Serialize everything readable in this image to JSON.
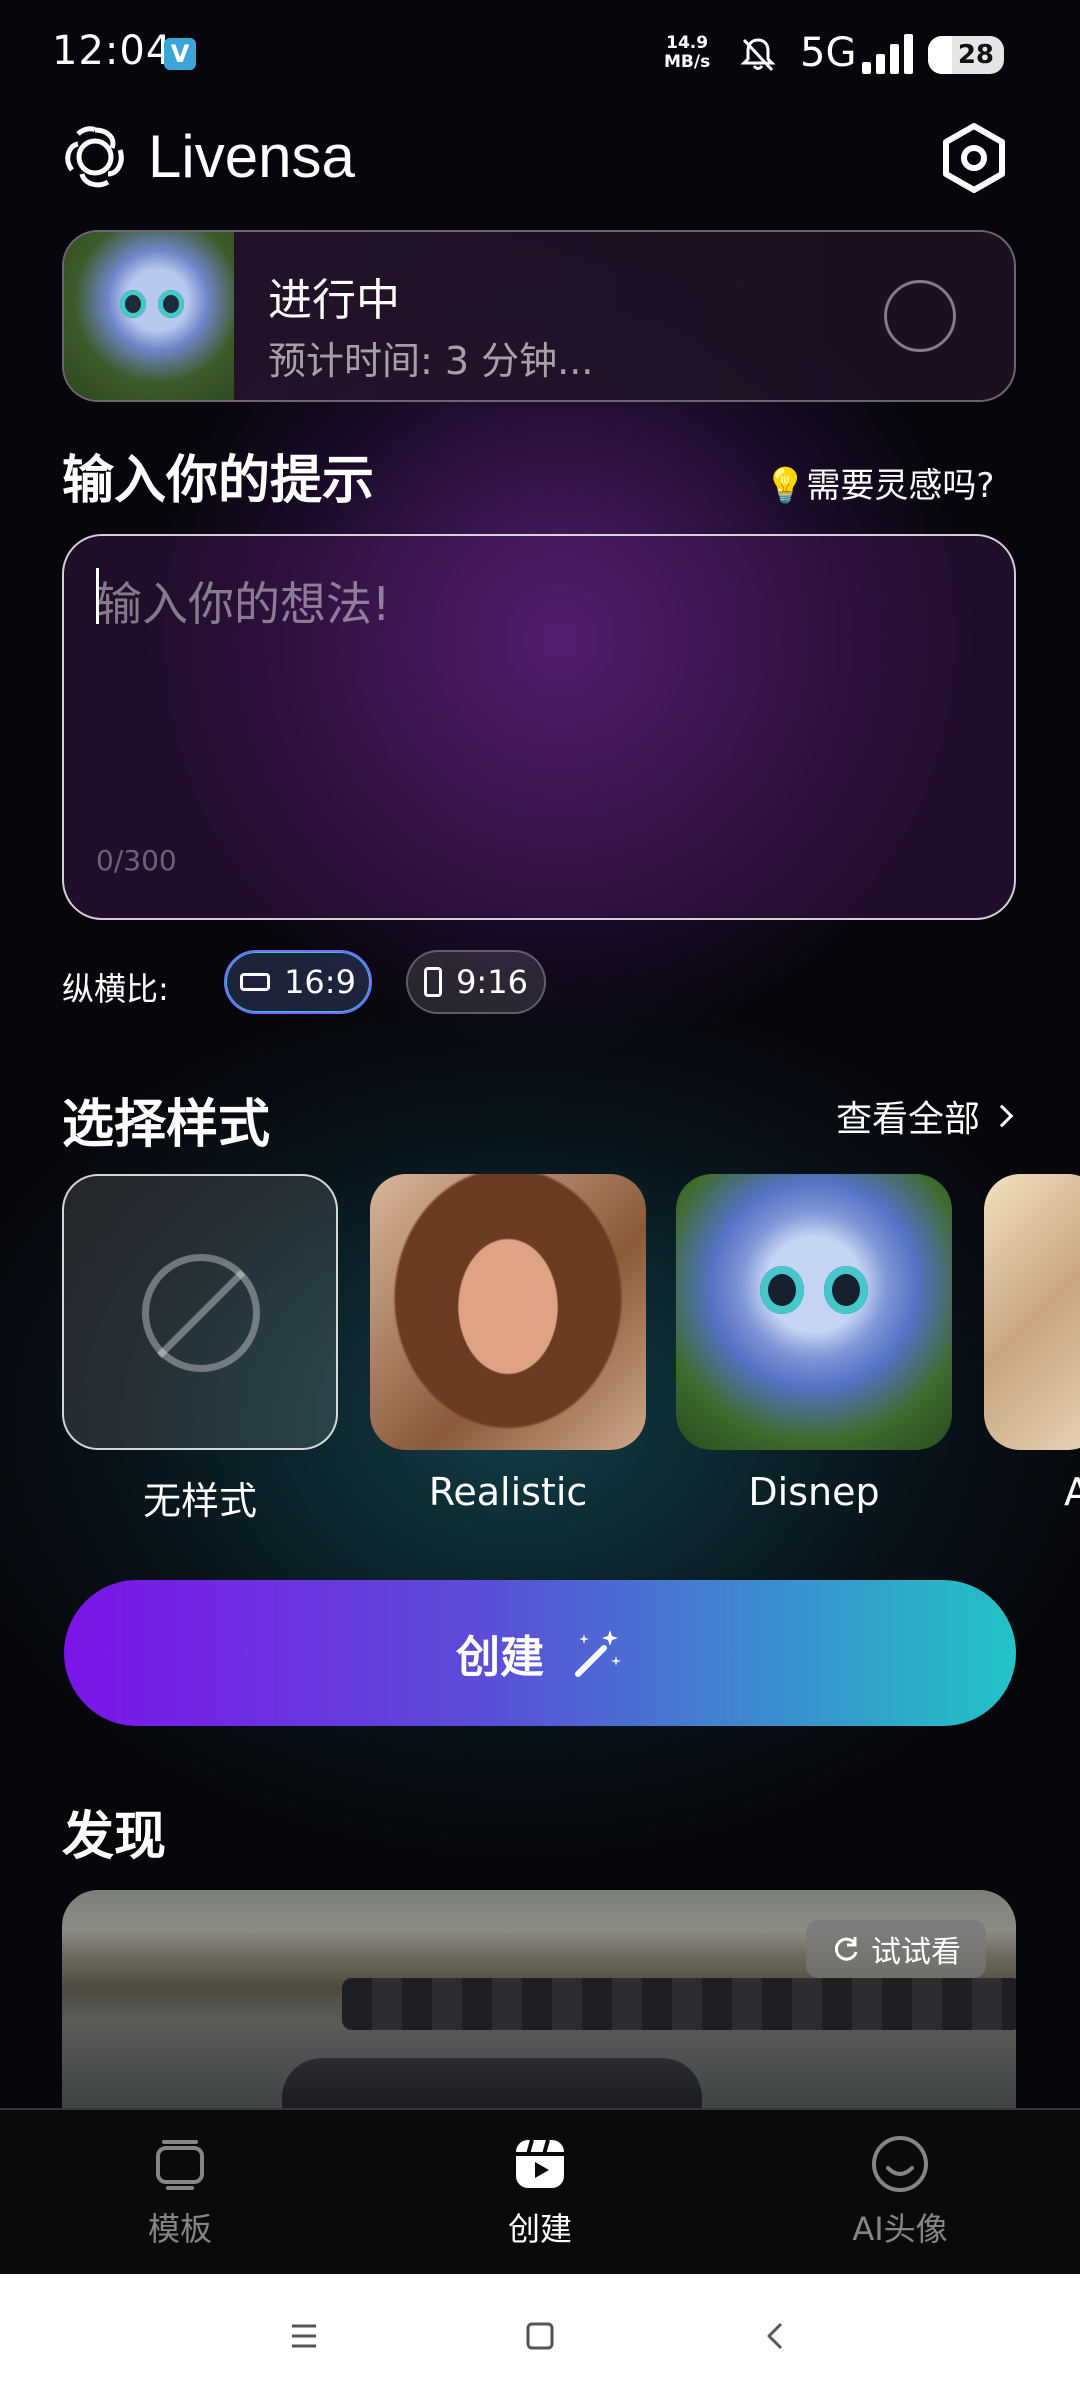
{
  "status_bar": {
    "time": "12:04",
    "app_badge": "V",
    "net_speed_top": "14.9",
    "net_speed_bottom": "MB/s",
    "network": "5G",
    "battery": "28"
  },
  "header": {
    "app_name": "Livensa",
    "settings_icon": "settings-hexagon-icon"
  },
  "progress": {
    "status": "进行中",
    "eta": "预计时间: 3 分钟..."
  },
  "prompt": {
    "title": "输入你的提示",
    "inspiration_link": "💡需要灵感吗?",
    "placeholder": "输入你的想法!",
    "value": "",
    "char_count": "0/300"
  },
  "aspect_ratio": {
    "label": "纵横比:",
    "options": [
      "16:9",
      "9:16"
    ],
    "selected": "16:9"
  },
  "styles": {
    "title": "选择样式",
    "view_all": "查看全部",
    "items": [
      {
        "label": "无样式"
      },
      {
        "label": "Realistic"
      },
      {
        "label": "Disnep"
      },
      {
        "label": "A"
      }
    ]
  },
  "create_button": {
    "label": "创建"
  },
  "discover": {
    "title": "发现",
    "try_label": "试试看"
  },
  "bottom_nav": {
    "items": [
      {
        "label": "模板",
        "icon": "template-icon"
      },
      {
        "label": "创建",
        "icon": "create-icon"
      },
      {
        "label": "AI头像",
        "icon": "avatar-icon"
      }
    ],
    "active": "创建"
  },
  "colors": {
    "accent_start": "#7c14e8",
    "accent_end": "#22c3c6",
    "background": "#05050a"
  }
}
